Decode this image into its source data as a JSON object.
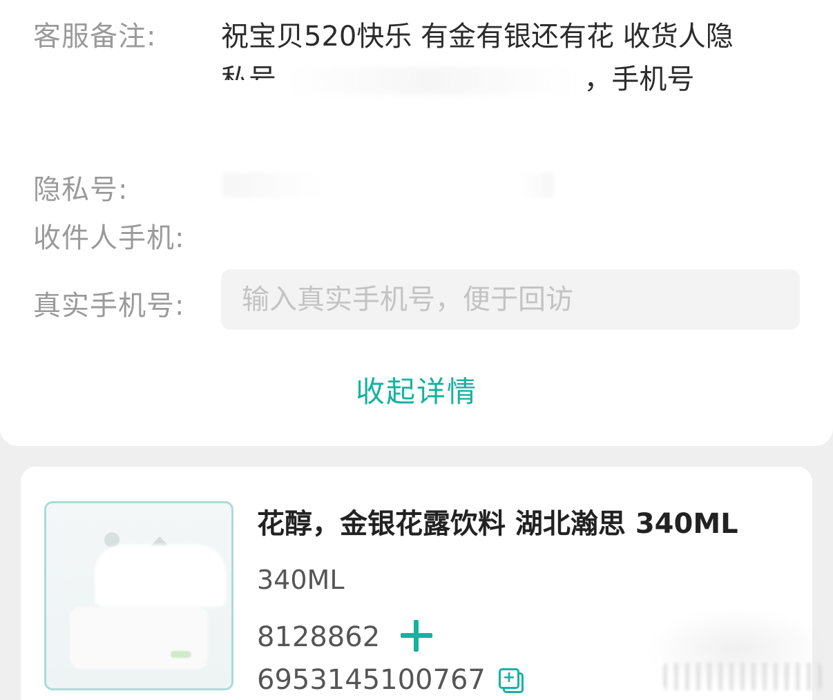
{
  "detail": {
    "remark_label": "客服备注:",
    "remark_line1": "祝宝贝520快乐 有金有银还有花 收货人隐",
    "remark_line2_start": "私号",
    "remark_line2_end": "，手机号",
    "privacy_label": "隐私号:",
    "receiver_phone_label": "收件人手机:",
    "real_phone_label": "真实手机号:",
    "real_phone_placeholder": "输入真实手机号，便于回访",
    "real_phone_value": "",
    "collapse_label": "收起详情"
  },
  "product": {
    "title": "花醇，金银花露饮料 湖北瀚思 340ML",
    "spec": "340ML",
    "code1": "8128862",
    "code2": "6953145100767"
  },
  "colors": {
    "accent": "#12b3a0",
    "label": "#9a9a9a",
    "text": "#2b2b2b",
    "background": "#efefef"
  },
  "icons": {
    "plus": "plus-icon",
    "copy": "copy-icon",
    "image_placeholder": "image-placeholder-icon"
  }
}
